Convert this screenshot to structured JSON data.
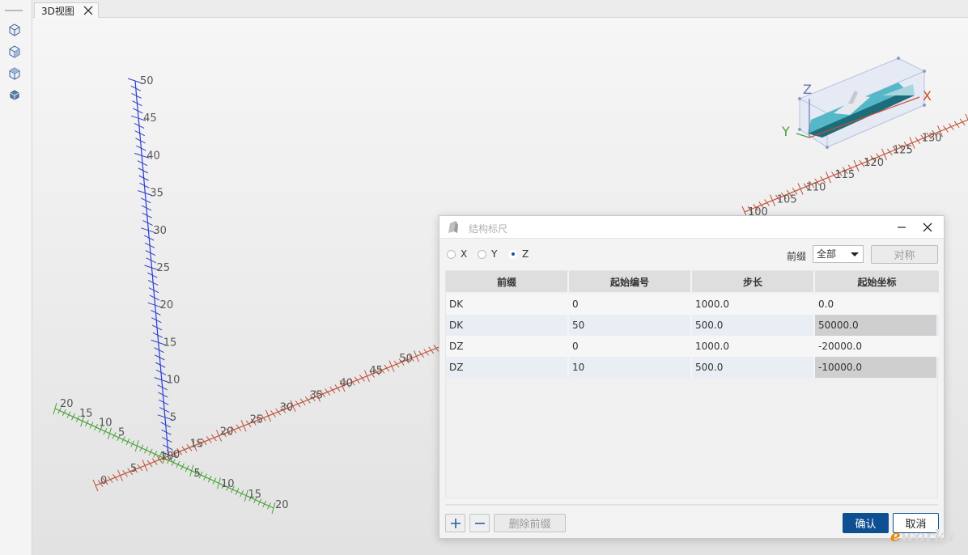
{
  "tabs": [
    {
      "label": "3D视图"
    }
  ],
  "axis_labels": {
    "z_axis": [
      "50",
      "45",
      "40",
      "35",
      "30",
      "25",
      "20",
      "15",
      "10",
      "5",
      "0"
    ],
    "x_axis": [
      "0",
      "5",
      "10",
      "15",
      "20",
      "25",
      "30",
      "35",
      "40",
      "45",
      "50",
      "100",
      "105",
      "110",
      "115",
      "120",
      "125",
      "130"
    ],
    "y_axis_left": [
      "20",
      "15",
      "10",
      "5"
    ],
    "y_axis_right": [
      "5",
      "10",
      "15",
      "20"
    ]
  },
  "view_cube": {
    "labels": {
      "x": "X",
      "y": "Y",
      "z": "Z"
    }
  },
  "dialog": {
    "title": "结构标尺",
    "radios": [
      {
        "label": "X",
        "checked": false
      },
      {
        "label": "Y",
        "checked": false
      },
      {
        "label": "Z",
        "checked": true
      }
    ],
    "prefix_label": "前缀",
    "prefix_select": {
      "value": "全部"
    },
    "symmetric_button": "对称",
    "table": {
      "columns": [
        "前缀",
        "起始编号",
        "步长",
        "起始坐标"
      ],
      "rows": [
        [
          "DK",
          "0",
          "1000.0",
          "0.0"
        ],
        [
          "DK",
          "50",
          "500.0",
          "50000.0"
        ],
        [
          "DZ",
          "0",
          "1000.0",
          "-20000.0"
        ],
        [
          "DZ",
          "10",
          "500.0",
          "-10000.0"
        ]
      ]
    },
    "delete_prefix_button": "删除前缀",
    "confirm_button": "确认",
    "cancel_button": "取消"
  },
  "watermark": {
    "prefix": "e",
    "suffix": "works"
  },
  "colors": {
    "accent": "#0e4e93",
    "x_axis": "#c0523a",
    "y_axis": "#4aa03a",
    "z_axis": "#2a3fd0"
  }
}
